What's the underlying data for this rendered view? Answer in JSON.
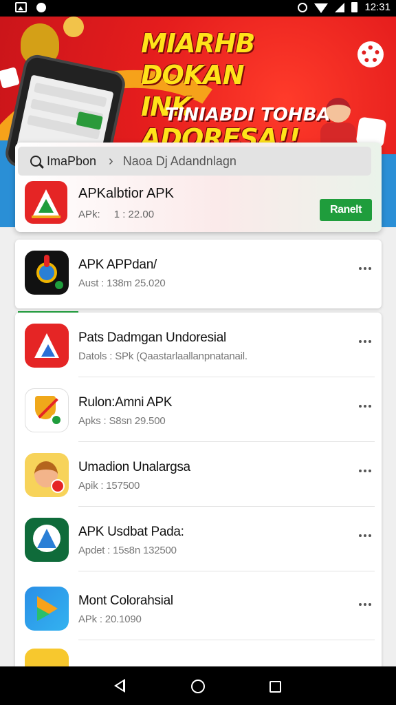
{
  "status_bar": {
    "time": "12:31",
    "icons": [
      "image-icon",
      "dot-icon",
      "alarm-icon",
      "wifi-icon",
      "signal-icon",
      "battery-icon"
    ]
  },
  "banner": {
    "headline": "MIARHB DOKAN\nINK ADORESA!!",
    "subline": "TINIABDI TOHBA!"
  },
  "search": {
    "label": "ImaPbon",
    "hint": "Naoa Dj Adandnlagn"
  },
  "featured": {
    "title": "APKalbtior APK",
    "meta_left": "APk:",
    "meta_right": "1 : 22.00",
    "install_label": "Ranelt",
    "accent": "#1f9d3c"
  },
  "apps": [
    {
      "title": "APK APPdan/",
      "meta": "Aust : 138m  25.020"
    },
    {
      "title": "Pats Dadmgan Undoresial",
      "meta": "Datols : SPk  (Qaastarlaallanpnatanail."
    },
    {
      "title": "Rulon:Amni APK",
      "meta": "Apks : S8sn  29.500"
    },
    {
      "title": "Umadion Unalargsa",
      "meta": "Apik : 157500"
    },
    {
      "title": "APK Usdbat Pada:",
      "meta": "Apdet : 15s8n  132500"
    },
    {
      "title": "Mont Colorahsial",
      "meta": "APk : 20.1090"
    }
  ],
  "colors": {
    "banner_red": "#e51d1d",
    "headline_yellow": "#ffe31a",
    "install_green": "#1f9d3c"
  }
}
